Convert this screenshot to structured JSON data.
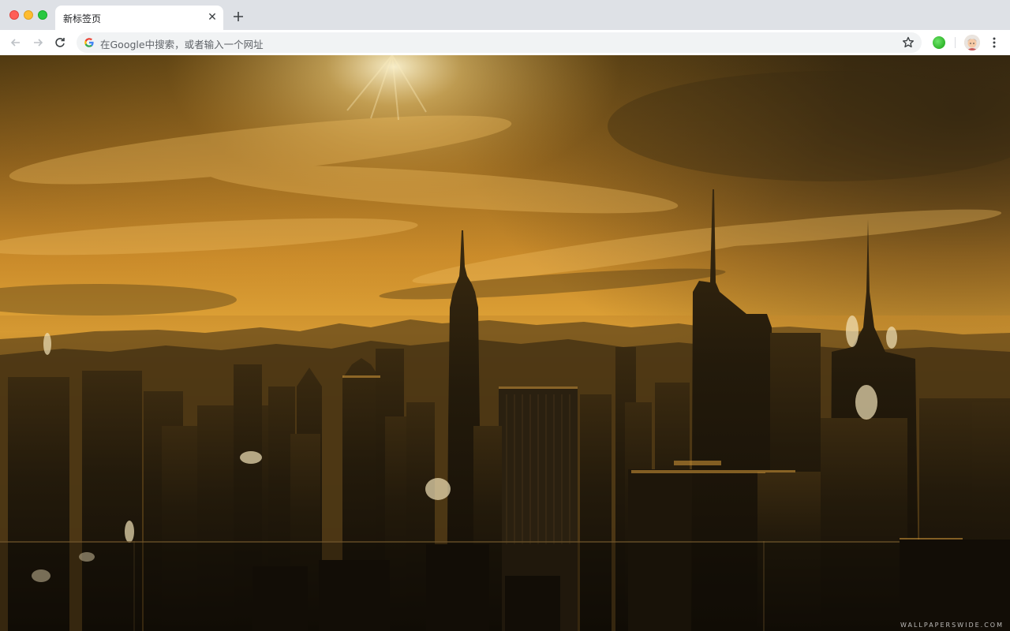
{
  "window": {
    "controls": [
      "close",
      "minimize",
      "maximize"
    ]
  },
  "tabs": [
    {
      "title": "新标签页",
      "close_icon": "close-icon",
      "active": true
    }
  ],
  "new_tab_icon": "plus-icon",
  "toolbar": {
    "back_icon": "arrow-left-icon",
    "forward_icon": "arrow-right-icon",
    "reload_icon": "reload-icon",
    "omnibox_placeholder": "在Google中搜索，或者输入一个网址",
    "search_engine_icon": "google-g-icon",
    "bookmark_icon": "star-icon",
    "extension_icon": "green-circle-extension-icon",
    "profile_icon": "avatar-icon",
    "menu_icon": "kebab-menu-icon"
  },
  "content": {
    "background": "city-skyline-sunset-wallpaper",
    "watermark": "WALLPAPERSWIDE.COM"
  },
  "colors": {
    "tabstrip_bg": "#dee1e6",
    "toolbar_bg": "#ffffff",
    "omnibox_bg": "#f1f3f4",
    "sky_gold": "#d99a2a",
    "skyline_dark": "#1c150b"
  }
}
